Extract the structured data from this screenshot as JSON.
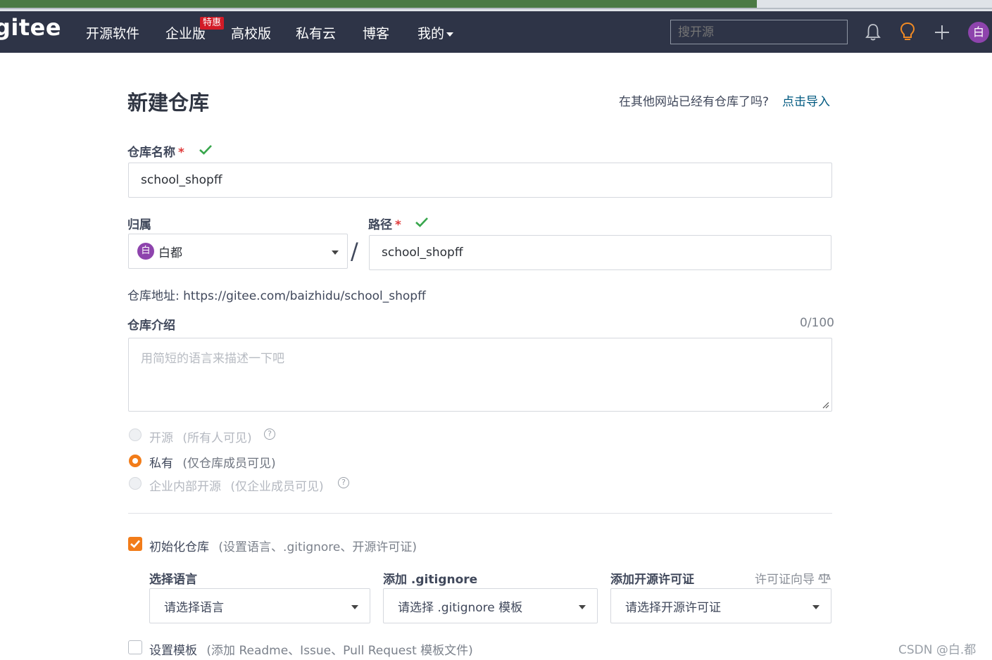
{
  "nav": {
    "logo": "gitee",
    "items": [
      "开源软件",
      "企业版",
      "高校版",
      "私有云",
      "博客",
      "我的"
    ],
    "badge": "特惠",
    "search_placeholder": "搜开源",
    "avatar": "白"
  },
  "page": {
    "title": "新建仓库",
    "import_question": "在其他网站已经有仓库了吗?",
    "import_link": "点击导入"
  },
  "form": {
    "repo_name_label": "仓库名称",
    "required_mark": "*",
    "repo_name_value": "school_shopff",
    "owner_label": "归属",
    "owner_avatar": "白",
    "owner_value": "白都",
    "slash": "/",
    "path_label": "路径",
    "path_value": "school_shopff",
    "repo_url": "仓库地址: https://gitee.com/baizhidu/school_shopff",
    "intro_label": "仓库介绍",
    "intro_counter": "0/100",
    "intro_placeholder": "用简短的语言来描述一下吧",
    "visibility": [
      {
        "label": "开源",
        "note": "(所有人可见)",
        "state": "disabled",
        "help": true
      },
      {
        "label": "私有",
        "note": "(仅仓库成员可见)",
        "state": "checked",
        "help": false
      },
      {
        "label": "企业内部开源",
        "note": "(仅企业成员可见)",
        "state": "disabled",
        "help": true
      }
    ],
    "init_label": "初始化仓库",
    "init_note": "(设置语言、.gitignore、开源许可证)",
    "language_label": "选择语言",
    "language_placeholder": "请选择语言",
    "gitignore_label": "添加 .gitignore",
    "gitignore_placeholder": "请选择 .gitignore 模板",
    "license_label": "添加开源许可证",
    "license_wizard": "许可证向导",
    "license_placeholder": "请选择开源许可证",
    "template_label": "设置模板",
    "template_note": "(添加 Readme、Issue、Pull Request 模板文件)"
  },
  "watermark": "CSDN @白.都"
}
